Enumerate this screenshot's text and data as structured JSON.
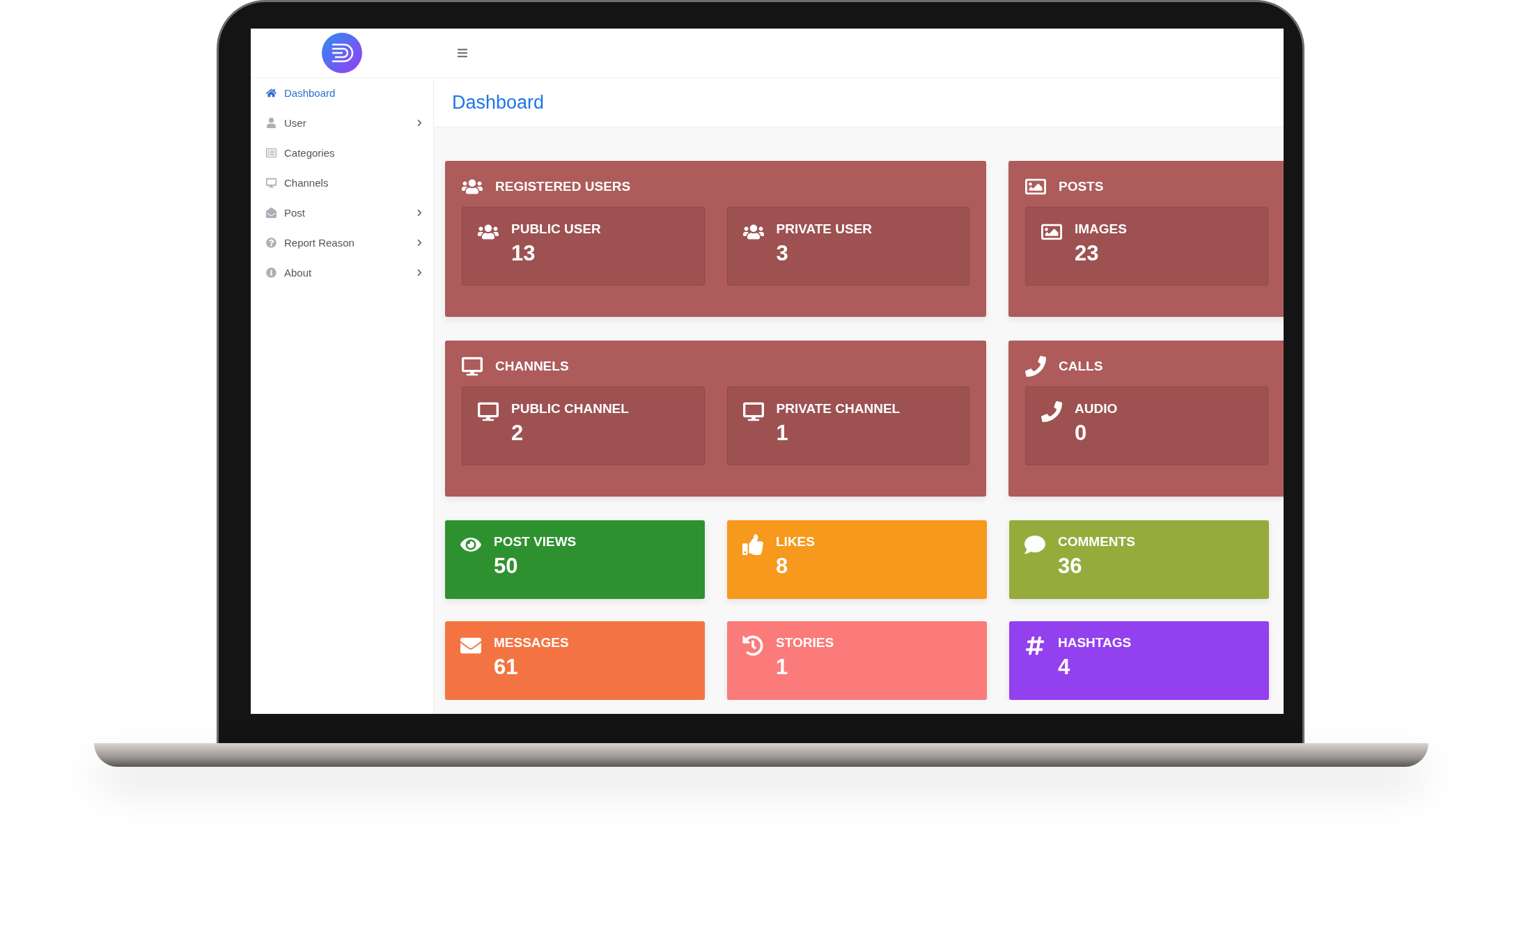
{
  "sidebar": {
    "items": [
      {
        "label": "Dashboard",
        "selected": true,
        "expandable": false
      },
      {
        "label": "User",
        "selected": false,
        "expandable": true
      },
      {
        "label": "Categories",
        "selected": false,
        "expandable": false
      },
      {
        "label": "Channels",
        "selected": false,
        "expandable": false
      },
      {
        "label": "Post",
        "selected": false,
        "expandable": true
      },
      {
        "label": "Report Reason",
        "selected": false,
        "expandable": true
      },
      {
        "label": "About",
        "selected": false,
        "expandable": true
      }
    ]
  },
  "page_title": "Dashboard",
  "groups": [
    {
      "title": "REGISTERED USERS",
      "stats": [
        {
          "label": "PUBLIC USER",
          "value": "13"
        },
        {
          "label": "PRIVATE USER",
          "value": "3"
        }
      ]
    },
    {
      "title": "POSTS",
      "stats": [
        {
          "label": "IMAGES",
          "value": "23"
        }
      ]
    },
    {
      "title": "CHANNELS",
      "stats": [
        {
          "label": "PUBLIC CHANNEL",
          "value": "2"
        },
        {
          "label": "PRIVATE CHANNEL",
          "value": "1"
        }
      ]
    },
    {
      "title": "CALLS",
      "stats": [
        {
          "label": "AUDIO",
          "value": "0"
        }
      ]
    }
  ],
  "tiles": [
    {
      "label": "POST VIEWS",
      "value": "50",
      "color": "#2e9130"
    },
    {
      "label": "LIKES",
      "value": "8",
      "color": "#f7991c"
    },
    {
      "label": "COMMENTS",
      "value": "36",
      "color": "#95ac3c"
    },
    {
      "label": "MESSAGES",
      "value": "61",
      "color": "#f37442"
    },
    {
      "label": "STORIES",
      "value": "1",
      "color": "#fb7a7a"
    },
    {
      "label": "HASHTAGS",
      "value": "4",
      "color": "#9340ef"
    }
  ]
}
